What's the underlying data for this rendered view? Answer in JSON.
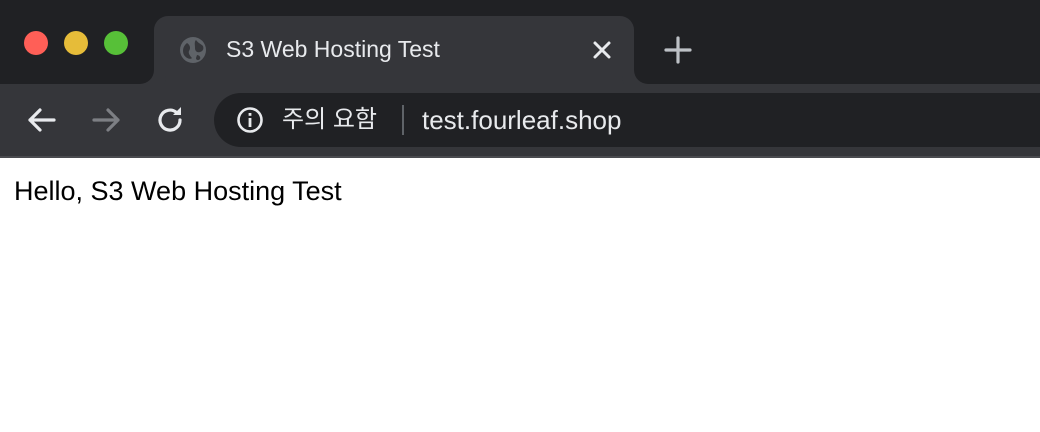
{
  "window": {
    "controls": [
      "close",
      "minimize",
      "zoom"
    ]
  },
  "tab": {
    "title": "S3 Web Hosting Test",
    "favicon": "globe-icon",
    "close_icon": "close-icon"
  },
  "new_tab": {
    "icon": "plus-icon"
  },
  "toolbar": {
    "back_icon": "arrow-left-icon",
    "forward_icon": "arrow-right-icon",
    "reload_icon": "reload-icon"
  },
  "omnibox": {
    "security_icon": "info-icon",
    "security_label": "주의 요함",
    "url": "test.fourleaf.shop"
  },
  "page": {
    "text": "Hello, S3 Web Hosting Test"
  },
  "colors": {
    "tabstrip_bg": "#202124",
    "toolbar_bg": "#35363a",
    "omnibox_bg": "#202124",
    "close_red": "#ff5f57",
    "minimize_yellow": "#e6bc39",
    "zoom_green": "#57c038"
  }
}
